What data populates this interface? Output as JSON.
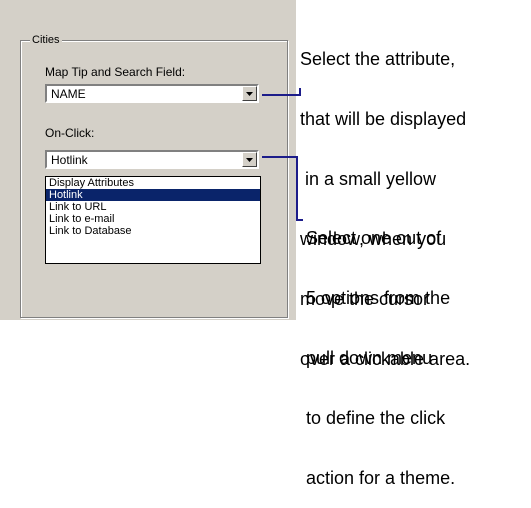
{
  "group": {
    "title": "Cities"
  },
  "map_tip": {
    "label": "Map Tip and Search Field:",
    "value": "NAME"
  },
  "on_click": {
    "label": "On-Click:",
    "value": "Hotlink",
    "options": [
      "Display Attributes",
      "Hotlink",
      "Link to URL",
      "Link to e-mail",
      "Link to Database"
    ],
    "selected_index": 1
  },
  "callouts": {
    "attribute": [
      "Select the attribute,",
      "that will be displayed",
      " in a small yellow",
      "window, when you",
      "move the cursor",
      "over a clickable area."
    ],
    "options": [
      "Select one out of",
      "5 options from the",
      "pull down menu",
      "to define the click",
      "action for a theme."
    ]
  },
  "colors": {
    "panel_bg": "#d4d0c8",
    "selection": "#0a246a",
    "connector": "#1c1c8a"
  },
  "icons": {
    "dropdown_arrow": "chevron-down-icon"
  }
}
